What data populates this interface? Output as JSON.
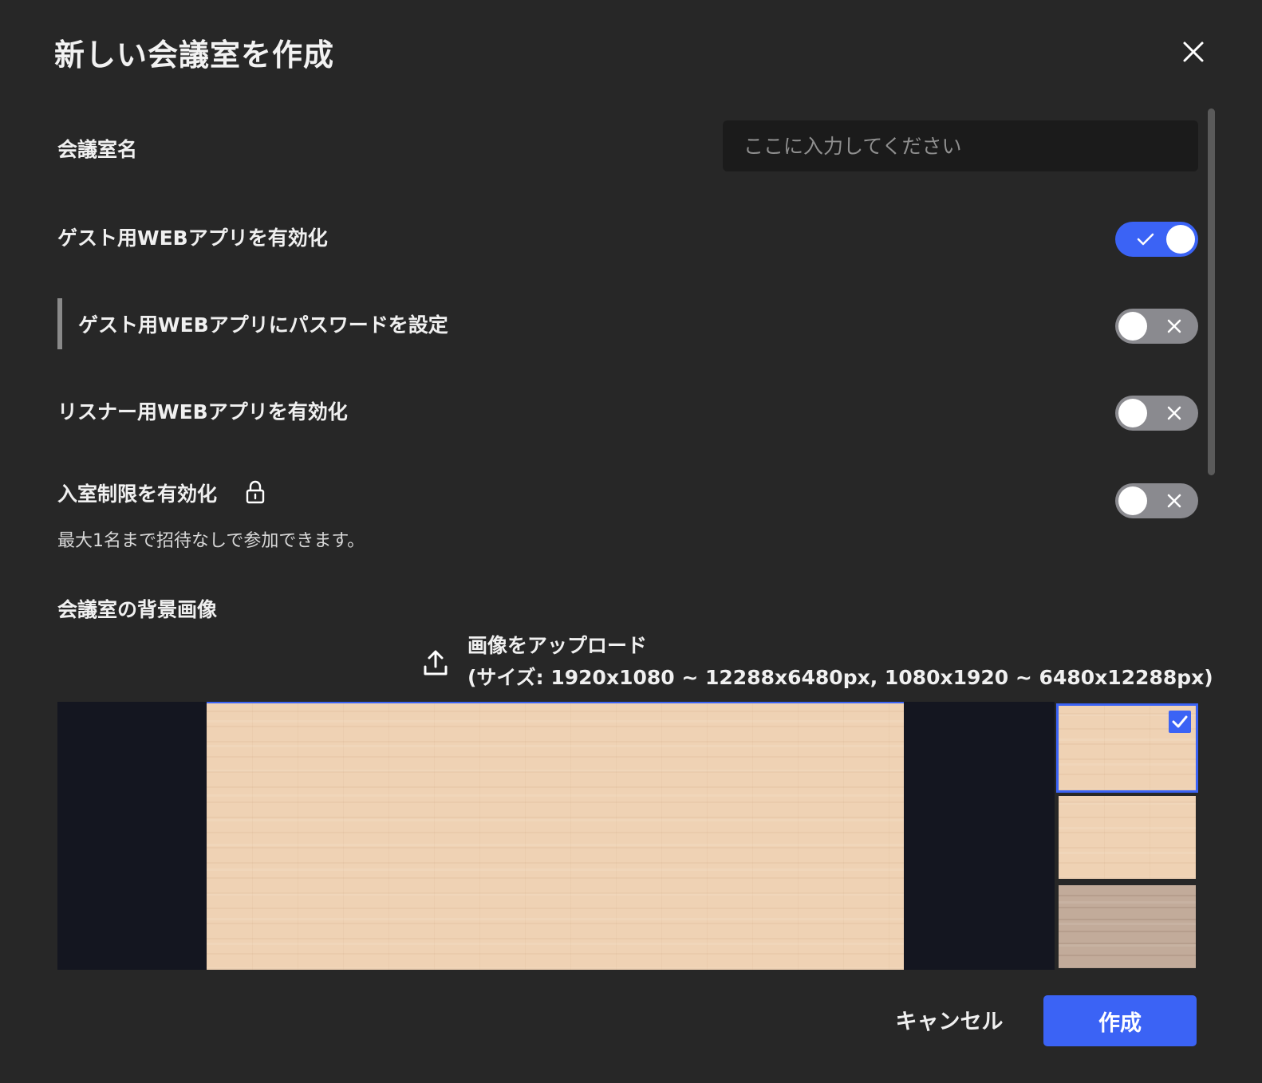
{
  "dialog": {
    "title": "新しい会議室を作成",
    "close_icon": "close-icon"
  },
  "room_name": {
    "label": "会議室名",
    "placeholder": "ここに入力してください",
    "value": ""
  },
  "settings": [
    {
      "label": "ゲスト用WEBアプリを有効化",
      "enabled": true
    },
    {
      "label": "ゲスト用WEBアプリにパスワードを設定",
      "enabled": false
    },
    {
      "label": "リスナー用WEBアプリを有効化",
      "enabled": false
    },
    {
      "label": "入室制限を有効化",
      "enabled": false,
      "icon": "lock-icon",
      "description": "最大1名まで招待なしで参加できます。"
    }
  ],
  "background": {
    "label": "会議室の背景画像",
    "upload_label": "画像をアップロード",
    "upload_size_note": "(サイズ: 1920x1080 ~ 12288x6480px, 1080x1920 ~ 6480x12288px)",
    "upload_icon": "upload-icon",
    "thumbnails": [
      {
        "name": "light-wood",
        "selected": true
      },
      {
        "name": "light-wood-2",
        "selected": false
      },
      {
        "name": "gray-wood",
        "selected": false
      }
    ]
  },
  "actions": {
    "cancel_label": "キャンセル",
    "create_label": "作成"
  },
  "colors": {
    "background": "#272727",
    "accent": "#3b63f5",
    "toggle_off": "#8a8a8f",
    "input_bg": "#1b1b1b"
  }
}
